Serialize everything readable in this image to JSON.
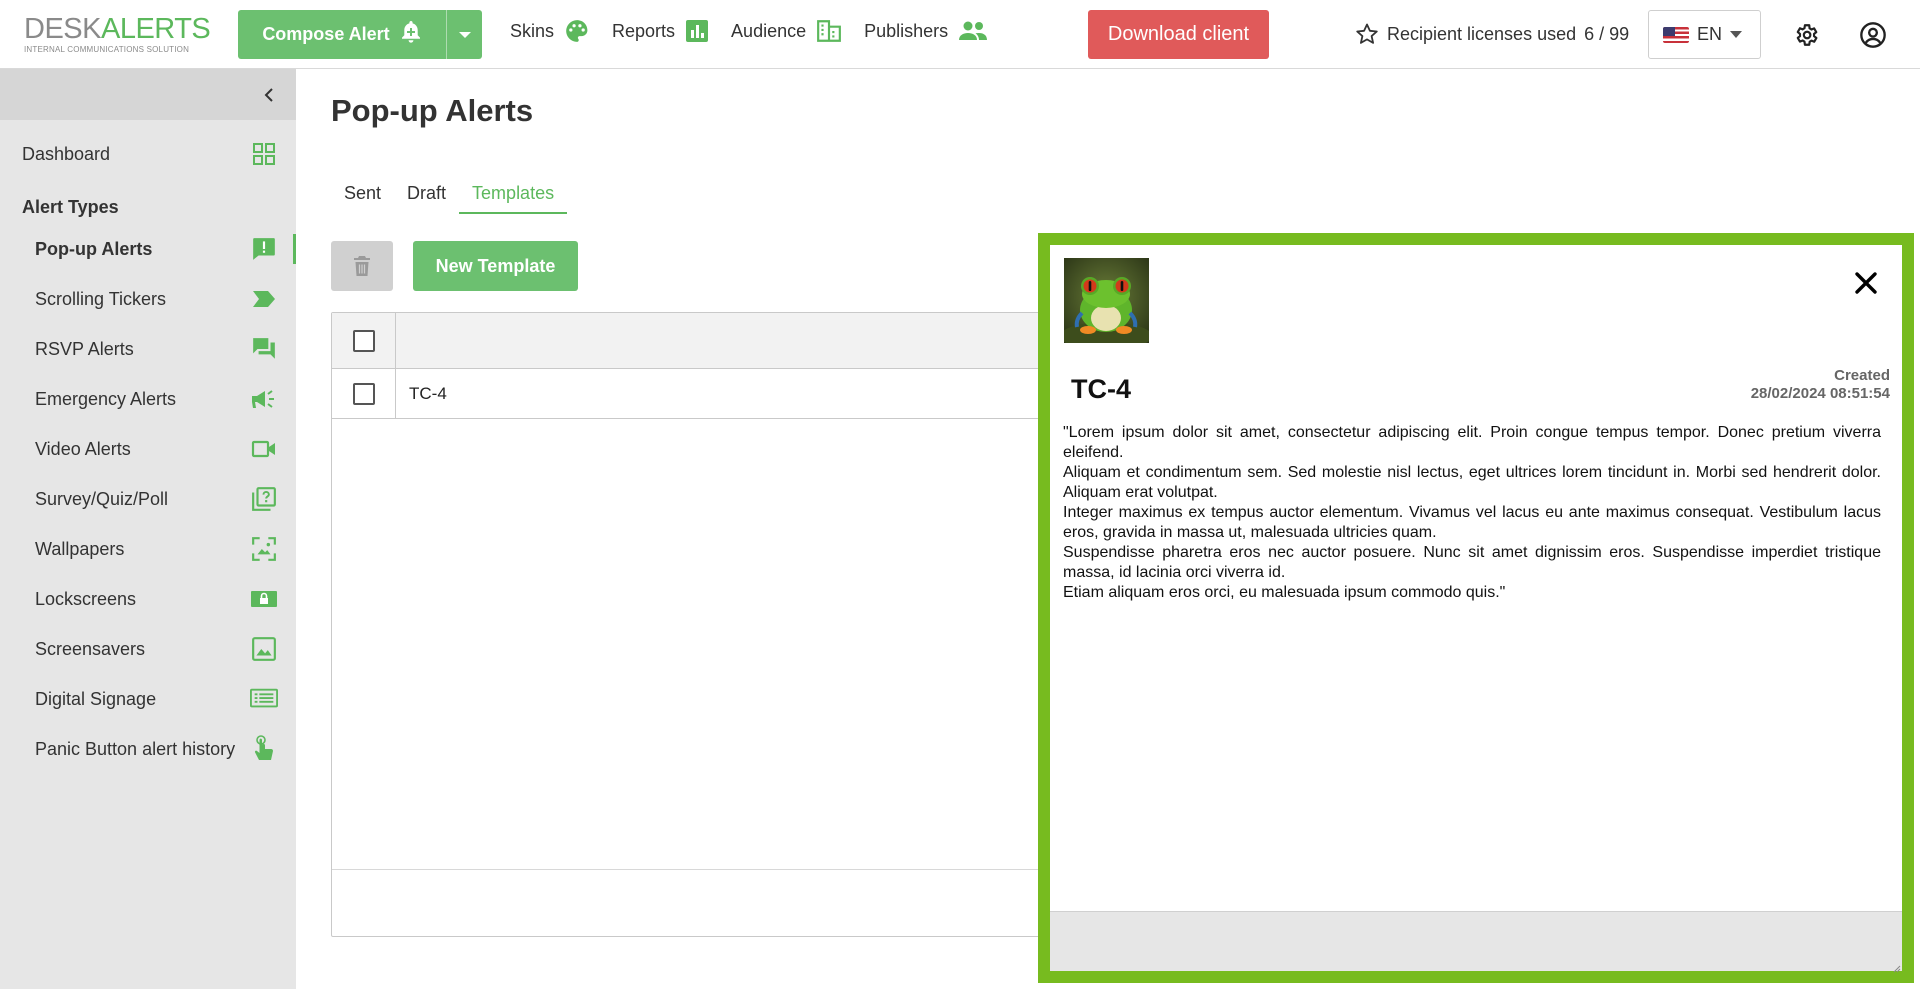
{
  "brand": {
    "logo_part1": "DESK",
    "logo_part2": "ALERTS",
    "tagline": "INTERNAL COMMUNICATIONS SOLUTION",
    "accent": "#5cb85c"
  },
  "topbar": {
    "compose_label": "Compose Alert",
    "nav": [
      {
        "label": "Skins",
        "icon": "palette-icon"
      },
      {
        "label": "Reports",
        "icon": "bar-chart-icon"
      },
      {
        "label": "Audience",
        "icon": "building-icon"
      },
      {
        "label": "Publishers",
        "icon": "people-icon"
      }
    ],
    "download_label": "Download client",
    "licenses_label": "Recipient licenses used",
    "licenses_value": "6 / 99",
    "language": "EN"
  },
  "sidebar": {
    "dashboard": "Dashboard",
    "section_heading": "Alert Types",
    "items": [
      {
        "label": "Pop-up Alerts",
        "icon": "alert-message-icon",
        "active": true
      },
      {
        "label": "Scrolling Tickers",
        "icon": "ticker-label-icon"
      },
      {
        "label": "RSVP Alerts",
        "icon": "chat-bubbles-icon"
      },
      {
        "label": "Emergency Alerts",
        "icon": "megaphone-icon"
      },
      {
        "label": "Video Alerts",
        "icon": "video-camera-icon"
      },
      {
        "label": "Survey/Quiz/Poll",
        "icon": "quiz-icon"
      },
      {
        "label": "Wallpapers",
        "icon": "wallpaper-icon"
      },
      {
        "label": "Lockscreens",
        "icon": "lock-screen-icon"
      },
      {
        "label": "Screensavers",
        "icon": "image-icon"
      },
      {
        "label": "Digital Signage",
        "icon": "signage-screen-icon"
      },
      {
        "label": "Panic Button alert history",
        "icon": "touch-hand-icon"
      }
    ]
  },
  "main": {
    "title": "Pop-up Alerts",
    "tabs": [
      "Sent",
      "Draft",
      "Templates"
    ],
    "active_tab": "Templates",
    "new_template_label": "New Template",
    "rows": [
      {
        "name": "TC-4"
      }
    ]
  },
  "popup": {
    "title": "TC-4",
    "created_label": "Created",
    "created_value": "28/02/2024 08:51:54",
    "border_color": "#77bb1f",
    "body": [
      "\"Lorem ipsum dolor sit amet, consectetur adipiscing elit. Proin congue tempus tempor. Donec pretium viverra eleifend.",
      "Aliquam et condimentum sem. Sed molestie nisl lectus, eget ultrices lorem tincidunt in. Morbi sed hendrerit dolor. Aliquam erat volutpat.",
      "Integer maximus ex tempus auctor elementum. Vivamus vel lacus eu ante maximus consequat. Vestibulum lacus eros, gravida in massa ut, malesuada ultricies quam.",
      "Suspendisse pharetra eros nec auctor posuere. Nunc sit amet dignissim eros. Suspendisse imperdiet tristique massa, id lacinia orci viverra id.",
      "Etiam aliquam eros orci, eu malesuada ipsum commodo quis.\""
    ]
  }
}
